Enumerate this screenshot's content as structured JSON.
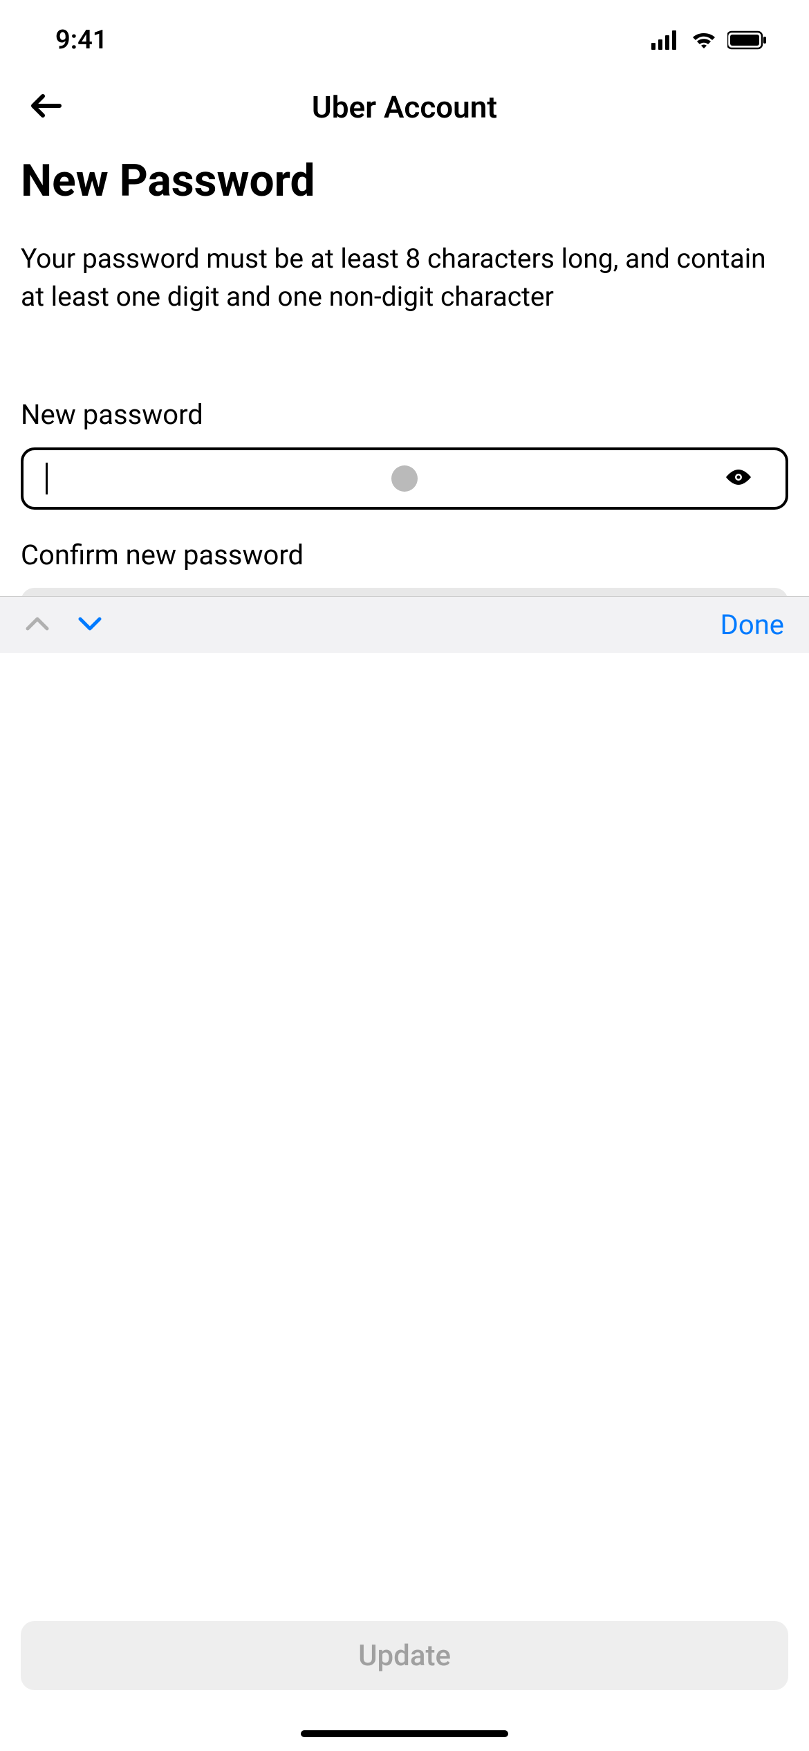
{
  "status_bar": {
    "time": "9:41"
  },
  "header": {
    "title": "Uber Account"
  },
  "page": {
    "title": "New Password",
    "description": "Your password must be at least 8 characters long, and contain at least one digit and one non-digit character"
  },
  "fields": {
    "new_password": {
      "label": "New password",
      "value": ""
    },
    "confirm_password": {
      "label": "Confirm new password",
      "value": ""
    }
  },
  "keyboard_toolbar": {
    "done_label": "Done"
  },
  "update_button": {
    "label": "Update"
  }
}
